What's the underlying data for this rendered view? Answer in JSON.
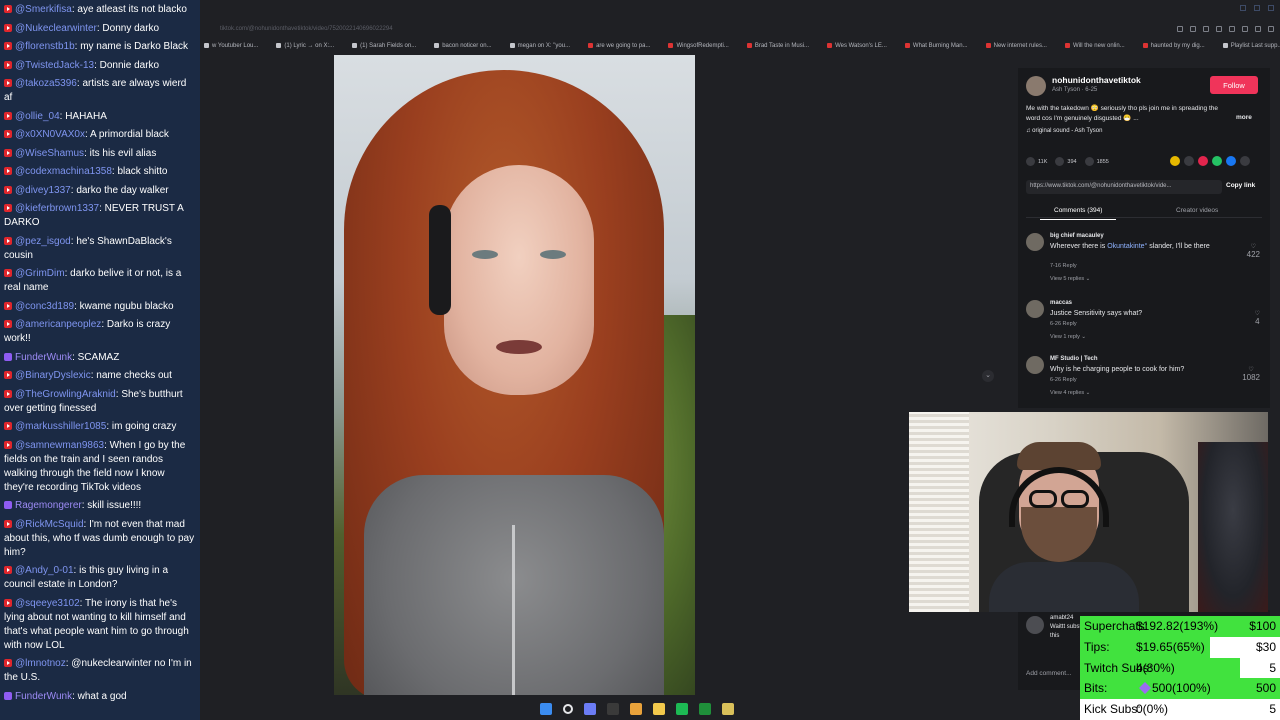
{
  "chat": {
    "messages": [
      {
        "platform": "yt",
        "user": "@Smerkifisa",
        "text": "aye atleast its not blacko"
      },
      {
        "platform": "yt",
        "user": "@Nukeclearwinter",
        "text": "Donny darko"
      },
      {
        "platform": "yt",
        "user": "@florenstb1b",
        "text": "my name is Darko Black"
      },
      {
        "platform": "yt",
        "user": "@TwistedJack-13",
        "text": "Donnie darko"
      },
      {
        "platform": "yt",
        "user": "@takoza5396",
        "text": "artists are always wierd af"
      },
      {
        "platform": "yt",
        "user": "@ollie_04",
        "text": "HAHAHA"
      },
      {
        "platform": "yt",
        "user": "@x0XN0VAX0x",
        "text": "A primordial black"
      },
      {
        "platform": "yt",
        "user": "@WiseShamus",
        "text": "its his evil alias"
      },
      {
        "platform": "yt",
        "user": "@codexmachina1358",
        "text": "black shitto"
      },
      {
        "platform": "yt",
        "user": "@divey1337",
        "text": "darko the day walker"
      },
      {
        "platform": "yt",
        "user": "@kieferbrown1337",
        "text": "NEVER TRUST A DARKO"
      },
      {
        "platform": "yt",
        "user": "@pez_isgod",
        "text": "he's ShawnDaBlack's cousin"
      },
      {
        "platform": "yt",
        "user": "@GrimDim",
        "text": "darko belive it or not, is a real name"
      },
      {
        "platform": "yt",
        "user": "@conc3d189",
        "text": "kwame ngubu blacko"
      },
      {
        "platform": "yt",
        "user": "@americanpeoplez",
        "text": "Darko is crazy work!!"
      },
      {
        "platform": "tw",
        "user": "FunderWunk",
        "text": "SCAMAZ"
      },
      {
        "platform": "yt",
        "user": "@BinaryDyslexic",
        "text": "name checks out"
      },
      {
        "platform": "yt",
        "user": "@TheGrowlingAraknid",
        "text": "She's butthurt over getting finessed"
      },
      {
        "platform": "yt",
        "user": "@markusshiller1085",
        "text": "im going crazy"
      },
      {
        "platform": "yt",
        "user": "@samnewman9863",
        "text": "When I go by the fields on the train and I seen randos walking through the field now I know they're recording TikTok videos"
      },
      {
        "platform": "tw",
        "user": "Ragemongerer",
        "text": "skill issue!!!!"
      },
      {
        "platform": "yt",
        "user": "@RickMcSquid",
        "text": "I'm not even that mad about this, who tf was dumb enough to pay him?"
      },
      {
        "platform": "yt",
        "user": "@Andy_0-01",
        "text": "is this guy living in a council estate in London?"
      },
      {
        "platform": "yt",
        "user": "@sqeeye3102",
        "text": "The irony is that he's lying about not wanting to kill himself and that's what people want him to go through with now LOL"
      },
      {
        "platform": "yt",
        "user": "@lmnotnoz",
        "text": "@nukeclearwinter no I'm in the U.S."
      },
      {
        "platform": "tw",
        "user": "FunderWunk",
        "text": "what a god"
      }
    ]
  },
  "browser": {
    "url": "tiktok.com/@nohunidonthavetiktok/video/7520022140696022294",
    "bookmarks": [
      {
        "label": "w Youtuber Lou...",
        "icon": "page"
      },
      {
        "label": "(1) Lyric → on X:...",
        "icon": "x"
      },
      {
        "label": "(1) Sarah Fields on...",
        "icon": "x"
      },
      {
        "label": "bacon noticer on...",
        "icon": "x"
      },
      {
        "label": "megan on X: \"you...",
        "icon": "x"
      },
      {
        "label": "are we going to pa...",
        "icon": "yt"
      },
      {
        "label": "WingsofRedempti...",
        "icon": "yt"
      },
      {
        "label": "Brad Taste in Musi...",
        "icon": "yt"
      },
      {
        "label": "Wes Watson's LE...",
        "icon": "yt"
      },
      {
        "label": "What Burning Man...",
        "icon": "yt"
      },
      {
        "label": "New internet rules...",
        "icon": "yt"
      },
      {
        "label": "Will the new onlin...",
        "icon": "yt"
      },
      {
        "label": "haunted by my dig...",
        "icon": "yt"
      },
      {
        "label": "Playlist Last supp...",
        "icon": "page"
      }
    ]
  },
  "tiktok": {
    "username": "nohunidonthavetiktok",
    "subline": "Ash Tyson · 6-25",
    "follow_label": "Follow",
    "caption": "Me with the takedown 😳 seriously tho pls join me in spreading the word cos I'm genuinely disgusted 😷 ...",
    "more_label": "more",
    "sound": "♫ original sound - Ash Tyson",
    "likes": "11K",
    "comments_count": "394",
    "saves": "1855",
    "link": "https://www.tiktok.com/@nohunidonthavetiktok/vide...",
    "copy_label": "Copy link",
    "tab_comments": "Comments (394)",
    "tab_creator": "Creator videos",
    "comments": [
      {
        "name": "big chief macauley",
        "text_pre": "Wherever there is ",
        "mention": "Okuntakinte°",
        "text_post": " slander, I'll be there",
        "meta": "7-16    Reply",
        "replies": "View 5 replies ⌄",
        "likes": "422"
      },
      {
        "name": "maccas",
        "text_pre": "Justice Sensitivity says what?",
        "mention": "",
        "text_post": "",
        "meta": "6-26    Reply",
        "replies": "View 1 reply ⌄",
        "likes": "4"
      },
      {
        "name": "MF Studio | Tech",
        "text_pre": "Why is he charging people to cook for him?",
        "mention": "",
        "text_post": "",
        "meta": "6-26    Reply",
        "replies": "View 4 replies ⌄",
        "likes": "1082"
      }
    ],
    "lower_comment": {
      "name": "amabt24",
      "text": "Waittt substac into this"
    },
    "add_comment": "Add comment..."
  },
  "stats": {
    "rows": [
      {
        "label": "Superchats:",
        "value": "$192.82(193%)",
        "goal": "$100",
        "progress": 1.0
      },
      {
        "label": "Tips:",
        "value": "$19.65(65%)",
        "goal": "$30",
        "progress": 0.65
      },
      {
        "label": "Twitch Subs:",
        "value": "4(80%)",
        "goal": "5",
        "progress": 0.8
      },
      {
        "label": "Bits:",
        "value": "500(100%)",
        "goal": "500",
        "progress": 1.0
      },
      {
        "label": "Kick Subs:",
        "value": "0(0%)",
        "goal": "5",
        "progress": 0.0
      }
    ]
  },
  "colors": {
    "chat_bg": "#1b2a44",
    "username": "#7f95f0",
    "youtube": "#e0262c",
    "twitch": "#8f5cf2",
    "progress_green": "#41e23e",
    "tiktok_follow": "#f0345a"
  },
  "taskbar": {
    "icons": [
      "windows-icon",
      "search-icon",
      "discord-icon",
      "obs-icon",
      "chrome-icon",
      "files-icon",
      "spotify-icon",
      "xbox-icon",
      "notes-icon"
    ]
  }
}
